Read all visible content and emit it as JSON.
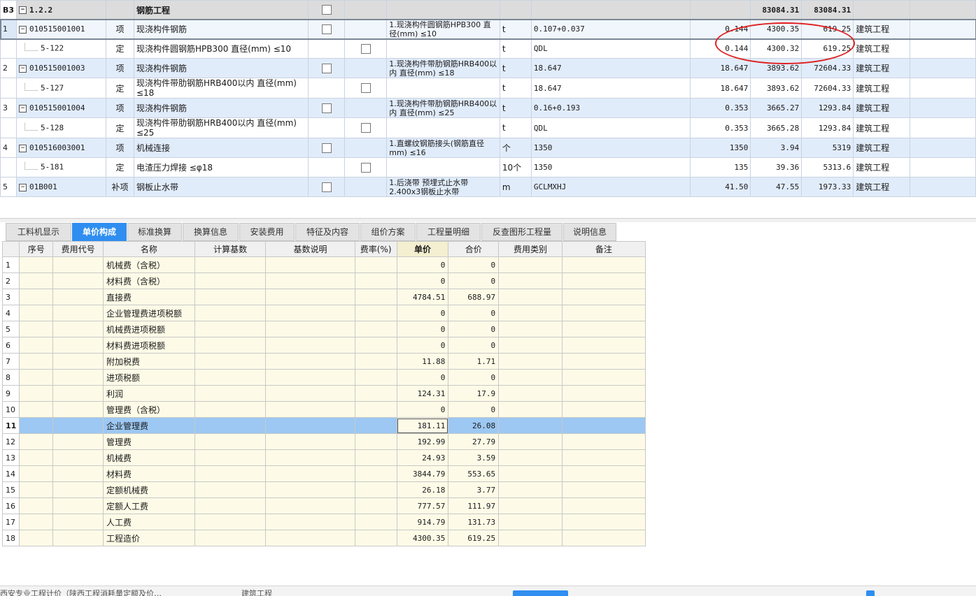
{
  "top_rows": [
    {
      "type": "sec",
      "no": "B3",
      "code": "1.2.2",
      "cat": "",
      "name": "钢筋工程",
      "feature": "",
      "unit": "",
      "expr": "",
      "qty": "",
      "price": "83084.31",
      "total": "83084.31",
      "major": ""
    },
    {
      "type": "item",
      "no": "1",
      "code": "010515001001",
      "cat": "项",
      "name": "现浇构件钢筋",
      "feature": "1.现浇构件圆钢筋HPB300 直径(mm) ≤10",
      "unit": "t",
      "expr": "0.107+0.037",
      "qty": "0.144",
      "price": "4300.35",
      "total": "619.25",
      "major": "建筑工程"
    },
    {
      "type": "quota",
      "no": "",
      "code": "5-122",
      "cat": "定",
      "name": "现浇构件圆钢筋HPB300 直径(mm) ≤10",
      "feature": "",
      "unit": "t",
      "expr": "QDL",
      "qty": "0.144",
      "price": "4300.32",
      "total": "619.25",
      "major": "建筑工程"
    },
    {
      "type": "item",
      "no": "2",
      "code": "010515001003",
      "cat": "项",
      "name": "现浇构件钢筋",
      "feature": "1.现浇构件带肋钢筋HRB400以内 直径(mm) ≤18",
      "unit": "t",
      "expr": "18.647",
      "qty": "18.647",
      "price": "3893.62",
      "total": "72604.33",
      "major": "建筑工程"
    },
    {
      "type": "quota",
      "no": "",
      "code": "5-127",
      "cat": "定",
      "name": "现浇构件带肋钢筋HRB400以内 直径(mm) ≤18",
      "feature": "",
      "unit": "t",
      "expr": "18.647",
      "qty": "18.647",
      "price": "3893.62",
      "total": "72604.33",
      "major": "建筑工程"
    },
    {
      "type": "item",
      "no": "3",
      "code": "010515001004",
      "cat": "项",
      "name": "现浇构件钢筋",
      "feature": "1.现浇构件带肋钢筋HRB400以内 直径(mm) ≤25",
      "unit": "t",
      "expr": "0.16+0.193",
      "qty": "0.353",
      "price": "3665.27",
      "total": "1293.84",
      "major": "建筑工程"
    },
    {
      "type": "quota",
      "no": "",
      "code": "5-128",
      "cat": "定",
      "name": "现浇构件带肋钢筋HRB400以内 直径(mm) ≤25",
      "feature": "",
      "unit": "t",
      "expr": "QDL",
      "qty": "0.353",
      "price": "3665.28",
      "total": "1293.84",
      "major": "建筑工程"
    },
    {
      "type": "item",
      "no": "4",
      "code": "010516003001",
      "cat": "项",
      "name": "机械连接",
      "feature": "1.直螺纹钢筋接头(钢筋直径mm) ≤16",
      "unit": "个",
      "expr": "1350",
      "qty": "1350",
      "price": "3.94",
      "total": "5319",
      "major": "建筑工程"
    },
    {
      "type": "quota",
      "no": "",
      "code": "5-181",
      "cat": "定",
      "name": "电渣压力焊接 ≤φ18",
      "feature": "",
      "unit": "10个",
      "expr": "1350",
      "qty": "135",
      "price": "39.36",
      "total": "5313.6",
      "major": "建筑工程"
    },
    {
      "type": "item",
      "no": "5",
      "code": "01B001",
      "cat": "补项",
      "name": "钢板止水带",
      "feature": "1.后浇带 预埋式止水带 2.400x3钢板止水带",
      "unit": "m",
      "expr": "GCLMXHJ",
      "qty": "41.50",
      "price": "47.55",
      "total": "1973.33",
      "major": "建筑工程"
    }
  ],
  "tabs": [
    "工料机显示",
    "单价构成",
    "标准换算",
    "换算信息",
    "安装费用",
    "特征及内容",
    "组价方案",
    "工程量明细",
    "反查图形工程量",
    "说明信息"
  ],
  "active_tab": 1,
  "cost_columns": [
    "序号",
    "费用代号",
    "名称",
    "计算基数",
    "基数说明",
    "费率(%)",
    "单价",
    "合价",
    "费用类别",
    "备注"
  ],
  "cost_rows": [
    {
      "no": "1",
      "name": "机械费（含税）",
      "unit_price": "0",
      "total": "0"
    },
    {
      "no": "2",
      "name": "材料费（含税）",
      "unit_price": "0",
      "total": "0"
    },
    {
      "no": "3",
      "name": "直接费",
      "unit_price": "4784.51",
      "total": "688.97"
    },
    {
      "no": "4",
      "name": "企业管理费进项税额",
      "unit_price": "0",
      "total": "0"
    },
    {
      "no": "5",
      "name": "机械费进项税额",
      "unit_price": "0",
      "total": "0"
    },
    {
      "no": "6",
      "name": "材料费进项税额",
      "unit_price": "0",
      "total": "0"
    },
    {
      "no": "7",
      "name": "附加税费",
      "unit_price": "11.88",
      "total": "1.71"
    },
    {
      "no": "8",
      "name": "进项税额",
      "unit_price": "0",
      "total": "0"
    },
    {
      "no": "9",
      "name": "利润",
      "unit_price": "124.31",
      "total": "17.9"
    },
    {
      "no": "10",
      "name": "管理费（含税）",
      "unit_price": "0",
      "total": "0"
    },
    {
      "no": "11",
      "name": "企业管理费",
      "unit_price": "181.11",
      "total": "26.08"
    },
    {
      "no": "12",
      "name": "管理费",
      "unit_price": "192.99",
      "total": "27.79"
    },
    {
      "no": "13",
      "name": "机械费",
      "unit_price": "24.93",
      "total": "3.59"
    },
    {
      "no": "14",
      "name": "材料费",
      "unit_price": "3844.79",
      "total": "553.65"
    },
    {
      "no": "15",
      "name": "定额机械费",
      "unit_price": "26.18",
      "total": "3.77"
    },
    {
      "no": "16",
      "name": "定额人工费",
      "unit_price": "777.57",
      "total": "111.97"
    },
    {
      "no": "17",
      "name": "人工费",
      "unit_price": "914.79",
      "total": "131.73"
    },
    {
      "no": "18",
      "name": "工程造价",
      "unit_price": "4300.35",
      "total": "619.25"
    }
  ],
  "selected_cost_row": 10,
  "status": {
    "left": "西安专业工程计价（陕西工程消耗量定额及价…",
    "mid": "建筑工程"
  },
  "colors": {
    "accent": "#2f8ef0",
    "annotation": "#e02020",
    "selected_row": "#9cc8f3",
    "cell_bg": "#fdfbe7"
  }
}
